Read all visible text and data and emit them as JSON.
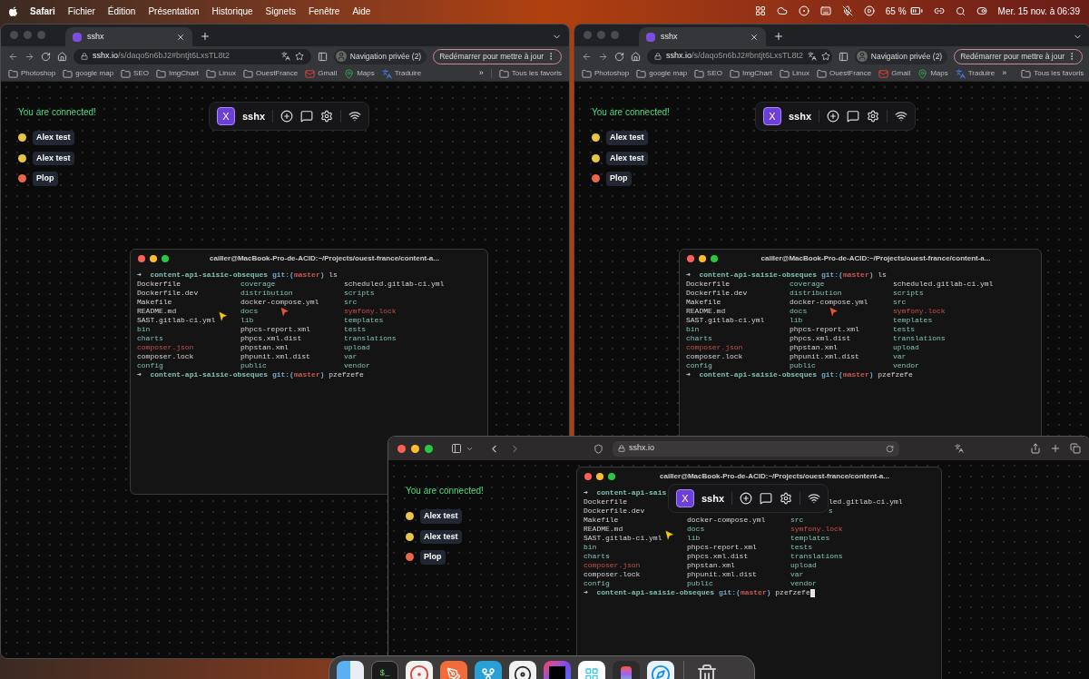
{
  "menu_bar": {
    "app": "Safari",
    "menus": [
      "Fichier",
      "Édition",
      "Présentation",
      "Historique",
      "Signets",
      "Fenêtre",
      "Aide"
    ],
    "battery": "65 %",
    "clock": "Mer. 15 nov. à 06:39"
  },
  "chrome_windows": [
    {
      "tab": {
        "title": "sshx",
        "selected": true
      },
      "url": {
        "host": "sshx.io",
        "path": "/s/daqo5n6bJ2#bntjt6LxsTL8t2"
      },
      "profile": "Navigation privée (2)",
      "update": "Redémarrer pour mettre à jour",
      "bookmarks": [
        {
          "label": "Photoshop",
          "kind": "folder"
        },
        {
          "label": "google map",
          "kind": "folder"
        },
        {
          "label": "SEO",
          "kind": "folder"
        },
        {
          "label": "ImgChart",
          "kind": "folder"
        },
        {
          "label": "Linux",
          "kind": "folder"
        },
        {
          "label": "OuestFrance",
          "kind": "folder"
        },
        {
          "label": "Gmail",
          "kind": "mail"
        },
        {
          "label": "Maps",
          "kind": "maps"
        },
        {
          "label": "Traduire",
          "kind": "translate"
        }
      ],
      "more": "»",
      "all_bookmarks": "Tous les favoris",
      "page": {
        "status": "You are connected!",
        "users": [
          {
            "name": "Alex test",
            "color": "#e8c547"
          },
          {
            "name": "Alex test",
            "color": "#e8c547"
          },
          {
            "name": "Plop",
            "color": "#e8674a"
          }
        ],
        "toolbar": {
          "logo": "X",
          "title": "sshx"
        },
        "terminal": {
          "title": "cailler@MacBook-Pro-de-ACID:~/Projects/ouest-france/content-a...",
          "lines": [
            {
              "kind": "prompt",
              "arrow": "➜",
              "dir": "content-api-saisie-obseques",
              "git_open": "git:(",
              "branch": "master",
              "git_close": ")",
              "command": "ls"
            },
            {
              "kind": "ls",
              "cells": [
                {
                  "text": "Dockerfile",
                  "kind": "file"
                },
                {
                  "text": "coverage",
                  "kind": "dir"
                },
                {
                  "text": "scheduled.gitlab-ci.yml",
                  "kind": "file"
                }
              ]
            },
            {
              "kind": "ls",
              "cells": [
                {
                  "text": "Dockerfile.dev",
                  "kind": "file"
                },
                {
                  "text": "distribution",
                  "kind": "dir"
                },
                {
                  "text": "scripts",
                  "kind": "dir"
                }
              ]
            },
            {
              "kind": "ls",
              "cells": [
                {
                  "text": "Makefile",
                  "kind": "file"
                },
                {
                  "text": "docker-compose.yml",
                  "kind": "file"
                },
                {
                  "text": "src",
                  "kind": "dir"
                }
              ]
            },
            {
              "kind": "ls",
              "cells": [
                {
                  "text": "README.md",
                  "kind": "file"
                },
                {
                  "text": "docs",
                  "kind": "dir"
                },
                {
                  "text": "symfony.lock",
                  "kind": "changed"
                }
              ]
            },
            {
              "kind": "ls",
              "cells": [
                {
                  "text": "SAST.gitlab-ci.yml",
                  "kind": "file"
                },
                {
                  "text": "lib",
                  "kind": "dir"
                },
                {
                  "text": "templates",
                  "kind": "dir"
                }
              ]
            },
            {
              "kind": "ls",
              "cells": [
                {
                  "text": "bin",
                  "kind": "dir"
                },
                {
                  "text": "phpcs-report.xml",
                  "kind": "file"
                },
                {
                  "text": "tests",
                  "kind": "dir"
                }
              ]
            },
            {
              "kind": "ls",
              "cells": [
                {
                  "text": "charts",
                  "kind": "dir"
                },
                {
                  "text": "phpcs.xml.dist",
                  "kind": "file"
                },
                {
                  "text": "translations",
                  "kind": "dir"
                }
              ]
            },
            {
              "kind": "ls",
              "cells": [
                {
                  "text": "composer.json",
                  "kind": "changed"
                },
                {
                  "text": "phpstan.xml",
                  "kind": "file"
                },
                {
                  "text": "upload",
                  "kind": "dir"
                }
              ]
            },
            {
              "kind": "ls",
              "cells": [
                {
                  "text": "composer.lock",
                  "kind": "file"
                },
                {
                  "text": "phpunit.xml.dist",
                  "kind": "file"
                },
                {
                  "text": "var",
                  "kind": "dir"
                }
              ]
            },
            {
              "kind": "ls",
              "cells": [
                {
                  "text": "config",
                  "kind": "dir"
                },
                {
                  "text": "public",
                  "kind": "dir"
                },
                {
                  "text": "vendor",
                  "kind": "dir"
                }
              ]
            },
            {
              "kind": "prompt",
              "arrow": "➜",
              "dir": "content-api-saisie-obseques",
              "git_open": "git:(",
              "branch": "master",
              "git_close": ")",
              "command": "pzefzefe"
            }
          ]
        }
      }
    },
    {
      "tab": {
        "title": "sshx",
        "selected": true
      },
      "url": {
        "host": "sshx.io",
        "path": "/s/daqo5n6bJ2#bntjt6LxsTL8t2"
      },
      "profile": "Navigation privée (2)",
      "update": "Redémarrer pour mettre à jour",
      "bookmarks": [
        {
          "label": "Photoshop",
          "kind": "folder"
        },
        {
          "label": "google map",
          "kind": "folder"
        },
        {
          "label": "SEO",
          "kind": "folder"
        },
        {
          "label": "ImgChart",
          "kind": "folder"
        },
        {
          "label": "Linux",
          "kind": "folder"
        },
        {
          "label": "OuestFrance",
          "kind": "folder"
        },
        {
          "label": "Gmail",
          "kind": "mail"
        },
        {
          "label": "Maps",
          "kind": "maps"
        },
        {
          "label": "Traduire",
          "kind": "translate"
        }
      ],
      "more": "»",
      "all_bookmarks": "Tous les favoris",
      "page": {
        "status": "You are connected!",
        "users": [
          {
            "name": "Alex test",
            "color": "#e8c547"
          },
          {
            "name": "Alex test",
            "color": "#e8c547"
          },
          {
            "name": "Plop",
            "color": "#e8674a"
          }
        ],
        "toolbar": {
          "logo": "X",
          "title": "sshx"
        },
        "terminal": {
          "title": "cailler@MacBook-Pro-de-ACID:~/Projects/ouest-france/content-a...",
          "lines": [
            {
              "kind": "prompt",
              "arrow": "➜",
              "dir": "content-api-saisie-obseques",
              "git_open": "git:(",
              "branch": "master",
              "git_close": ")",
              "command": "ls"
            },
            {
              "kind": "ls",
              "cells": [
                {
                  "text": "Dockerfile",
                  "kind": "file"
                },
                {
                  "text": "coverage",
                  "kind": "dir"
                },
                {
                  "text": "scheduled.gitlab-ci.yml",
                  "kind": "file"
                }
              ]
            },
            {
              "kind": "ls",
              "cells": [
                {
                  "text": "Dockerfile.dev",
                  "kind": "file"
                },
                {
                  "text": "distribution",
                  "kind": "dir"
                },
                {
                  "text": "scripts",
                  "kind": "dir"
                }
              ]
            },
            {
              "kind": "ls",
              "cells": [
                {
                  "text": "Makefile",
                  "kind": "file"
                },
                {
                  "text": "docker-compose.yml",
                  "kind": "file"
                },
                {
                  "text": "src",
                  "kind": "dir"
                }
              ]
            },
            {
              "kind": "ls",
              "cells": [
                {
                  "text": "README.md",
                  "kind": "file"
                },
                {
                  "text": "docs",
                  "kind": "dir"
                },
                {
                  "text": "symfony.lock",
                  "kind": "changed"
                }
              ]
            },
            {
              "kind": "ls",
              "cells": [
                {
                  "text": "SAST.gitlab-ci.yml",
                  "kind": "file"
                },
                {
                  "text": "lib",
                  "kind": "dir"
                },
                {
                  "text": "templates",
                  "kind": "dir"
                }
              ]
            },
            {
              "kind": "ls",
              "cells": [
                {
                  "text": "bin",
                  "kind": "dir"
                },
                {
                  "text": "phpcs-report.xml",
                  "kind": "file"
                },
                {
                  "text": "tests",
                  "kind": "dir"
                }
              ]
            },
            {
              "kind": "ls",
              "cells": [
                {
                  "text": "charts",
                  "kind": "dir"
                },
                {
                  "text": "phpcs.xml.dist",
                  "kind": "file"
                },
                {
                  "text": "translations",
                  "kind": "dir"
                }
              ]
            },
            {
              "kind": "ls",
              "cells": [
                {
                  "text": "composer.json",
                  "kind": "changed"
                },
                {
                  "text": "phpstan.xml",
                  "kind": "file"
                },
                {
                  "text": "upload",
                  "kind": "dir"
                }
              ]
            },
            {
              "kind": "ls",
              "cells": [
                {
                  "text": "composer.lock",
                  "kind": "file"
                },
                {
                  "text": "phpunit.xml.dist",
                  "kind": "file"
                },
                {
                  "text": "var",
                  "kind": "dir"
                }
              ]
            },
            {
              "kind": "ls",
              "cells": [
                {
                  "text": "config",
                  "kind": "dir"
                },
                {
                  "text": "public",
                  "kind": "dir"
                },
                {
                  "text": "vendor",
                  "kind": "dir"
                }
              ]
            },
            {
              "kind": "prompt",
              "arrow": "➜",
              "dir": "content-api-saisie-obseques",
              "git_open": "git:(",
              "branch": "master",
              "git_close": ")",
              "command": "pzefzefe"
            }
          ]
        }
      }
    }
  ],
  "safari_window": {
    "url": "sshx.io",
    "page": {
      "status": "You are connected!",
      "users": [
        {
          "name": "Alex test",
          "color": "#e8c547"
        },
        {
          "name": "Alex test",
          "color": "#e8c547"
        },
        {
          "name": "Plop",
          "color": "#e8674a"
        }
      ],
      "toolbar": {
        "logo": "X",
        "title": "sshx"
      },
      "terminal": {
        "title": "cailler@MacBook-Pro-de-ACID:~/Projects/ouest-france/content-a...",
        "lines": [
          {
            "kind": "prompt",
            "arrow": "➜",
            "dir": "content-api-sais"
          },
          {
            "kind": "ls",
            "cells": [
              {
                "text": "Dockerfile",
                "kind": "file"
              },
              null,
              {
                "text": "led.gitlab-ci.yml",
                "kind": "file",
                "cut_start": true
              }
            ]
          },
          {
            "kind": "ls",
            "cells": [
              {
                "text": "Dockerfile.dev",
                "kind": "file"
              },
              null,
              {
                "text": "s",
                "kind": "dir",
                "cut_start": true
              }
            ]
          },
          {
            "kind": "ls",
            "cells": [
              {
                "text": "Makefile",
                "kind": "file"
              },
              {
                "text": "docker-compose.yml",
                "kind": "file"
              },
              {
                "text": "src",
                "kind": "dir"
              }
            ]
          },
          {
            "kind": "ls",
            "cells": [
              {
                "text": "README.md",
                "kind": "file"
              },
              {
                "text": "docs",
                "kind": "dir"
              },
              {
                "text": "symfony.lock",
                "kind": "changed"
              }
            ]
          },
          {
            "kind": "ls",
            "cells": [
              {
                "text": "SAST.gitlab-ci.yml",
                "kind": "file"
              },
              {
                "text": "lib",
                "kind": "dir"
              },
              {
                "text": "templates",
                "kind": "dir"
              }
            ]
          },
          {
            "kind": "ls",
            "cells": [
              {
                "text": "bin",
                "kind": "dir"
              },
              {
                "text": "phpcs-report.xml",
                "kind": "file"
              },
              {
                "text": "tests",
                "kind": "dir"
              }
            ]
          },
          {
            "kind": "ls",
            "cells": [
              {
                "text": "charts",
                "kind": "dir"
              },
              {
                "text": "phpcs.xml.dist",
                "kind": "file"
              },
              {
                "text": "translations",
                "kind": "dir"
              }
            ]
          },
          {
            "kind": "ls",
            "cells": [
              {
                "text": "composer.json",
                "kind": "changed"
              },
              {
                "text": "phpstan.xml",
                "kind": "file"
              },
              {
                "text": "upload",
                "kind": "dir"
              }
            ]
          },
          {
            "kind": "ls",
            "cells": [
              {
                "text": "composer.lock",
                "kind": "file"
              },
              {
                "text": "phpunit.xml.dist",
                "kind": "file"
              },
              {
                "text": "var",
                "kind": "dir"
              }
            ]
          },
          {
            "kind": "ls",
            "cells": [
              {
                "text": "config",
                "kind": "dir"
              },
              {
                "text": "public",
                "kind": "dir"
              },
              {
                "text": "vendor",
                "kind": "dir"
              }
            ]
          },
          {
            "kind": "prompt",
            "arrow": "➜",
            "dir": "content-api-saisie-obseques",
            "git_open": "git:(",
            "branch": "master",
            "git_close": ")",
            "command": "pzefzefe",
            "cursor": true
          }
        ]
      }
    }
  },
  "dock": [
    {
      "kind": "terminal",
      "glyph": "$_"
    },
    {
      "kind": "chrome"
    },
    {
      "kind": "pen"
    },
    {
      "kind": "fork"
    },
    {
      "kind": "wheel"
    },
    {
      "kind": "ide"
    },
    {
      "kind": "chat"
    },
    {
      "kind": "design"
    },
    {
      "kind": "compass"
    },
    {
      "kind": "trash"
    }
  ]
}
